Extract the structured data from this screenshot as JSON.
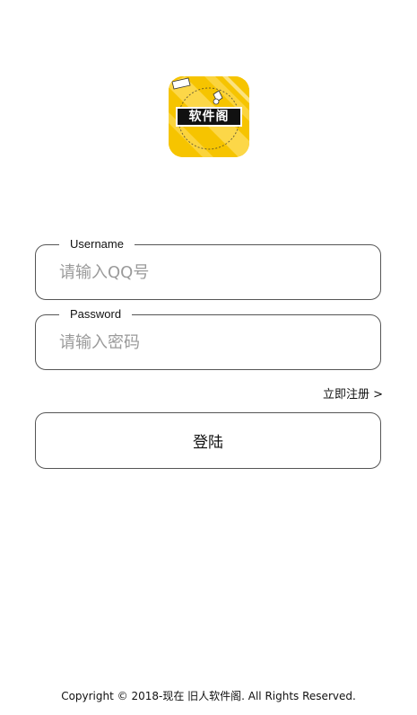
{
  "app": {
    "logo_text": "软件阁",
    "logo_icon": "app-logo-icon",
    "brand_color": "#F6C400"
  },
  "form": {
    "username": {
      "label": "Username",
      "placeholder": "请输入QQ号",
      "value": ""
    },
    "password": {
      "label": "Password",
      "placeholder": "请输入密码",
      "value": ""
    },
    "register_link": "立即注册 >",
    "login_button": "登陆"
  },
  "footer": {
    "copyright": "Copyright © 2018-现在 旧人软件阁. All Rights Reserved."
  },
  "colors": {
    "border": "#555555",
    "placeholder": "#9a9a9a",
    "text": "#111111",
    "background": "#ffffff"
  }
}
